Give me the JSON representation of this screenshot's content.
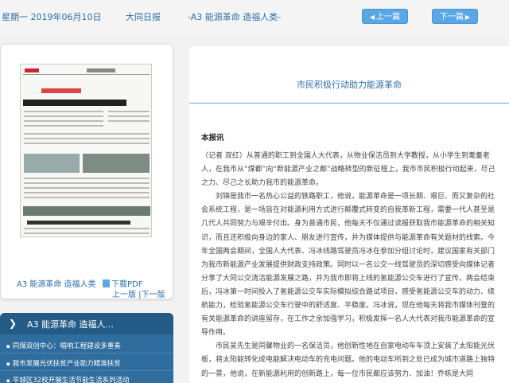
{
  "topbar": {
    "date": "星期一 2019年06月10日",
    "paper": "大同日报",
    "page": "-A3 能源革命 造福人类-",
    "prev_label": "上一篇",
    "next_label": "下一篇"
  },
  "thumbnail": {
    "headline": "同煤双创中心:唱响工程建设多重奏",
    "caption": "A3 能源革命 造福人类",
    "pdf_label": "下载PDF",
    "pager": "上一版 |下一版"
  },
  "article_list": {
    "section_title": "A3 能源革命 造福人...",
    "items": [
      "同煤双创中心：唱响工程建设多重奏",
      "我市发展光伏扶贫产业助力精准扶贫",
      "平城区32校开展生活节能生活系列活动"
    ]
  },
  "article": {
    "title": "市民积极行动助力能源革命",
    "byline": "本报讯",
    "paragraphs": [
      "（记者 双红）从普通的职工到全国人大代表，从物业保洁员到大学教授，从小学生到耄耋老人，在我市从“煤都”向“新能源产业之都”战略转型的新征程上，我市市民积极行动起来，尽己之力、尽己之长助力我市的能源革命。",
      "刘锦是我市一名热心公益的铁路职工，他说，能源革命是一项长期、艰巨、而又复杂的社会系统工程，是一场旨在对能源利用方式进行颠覆式转变的自我革新工程，需要一代人甚至是几代人共同努力与艰辛付出。身为普通市民，他每天不仅通过读报获取我市能源革命的相关知识，而且还积极向身边的家人、朋友进行宣传，并为媒体提供与能源革命有关题材的线索。今年全国两会期间，全国人大代表、冯冰线路驾驶员冯冰在参加分组讨论时，建议国家有关部门为我市新能源产业发展提供财政支持政策。同时以一名公交一线驾驶员的深切感受向媒体记者分享了大同公交清洁能源发展之路，并为我市即将上线的氢能源公交车进行了宣传。两会结束后，冯冰第一时间投入了氢能源公交车实际模拟综合路试项目，感受氢能源公交车的动力、续航能力，检验氢能源公交车行驶中的舒适度、平稳度。冯冰说，现在他每天将我市媒体刊登的有关能源革命的讲座留存，在工作之余加强学习，积极发挥一名人大代表对我市能源革命的宣导作用。",
      "市民吴先生是同馨物业的一名保洁员，他创新性地在自家电动车车顶上安装了太阳能光伏板，将太阳能转化成电能解决电动车的充电问题。他的电动车所到之处已成为城市道路上独特的一景，他说，在新能源利用的创新路上，每一位市民都应该努力、加油！乔栋是大同"
    ]
  }
}
